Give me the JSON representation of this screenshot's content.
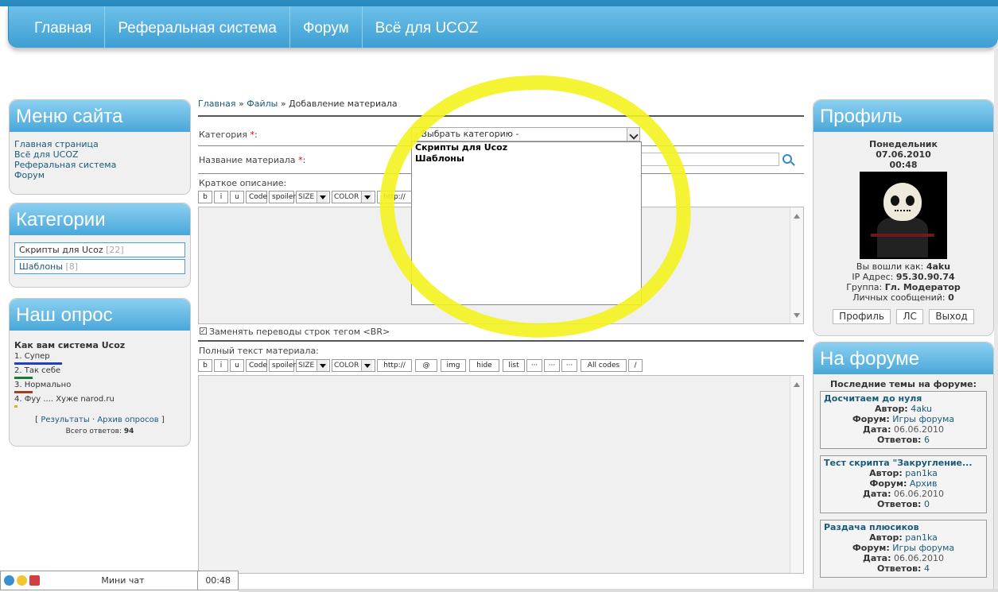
{
  "nav": [
    "Главная",
    "Реферальная система",
    "Форум",
    "Всё для UCOZ"
  ],
  "site_menu": {
    "title": "Меню сайта",
    "links": [
      "Главная страница",
      "Всё для UCOZ",
      "Реферальная система",
      "Форум"
    ]
  },
  "categories": {
    "title": "Категории",
    "items": [
      {
        "label": "Скрипты для Ucoz",
        "count": "[22]"
      },
      {
        "label": "Шаблоны",
        "count": "[8]"
      }
    ]
  },
  "poll": {
    "title": "Наш опрос",
    "question": "Как вам система Ucoz",
    "answers": [
      {
        "label": "1. Супер",
        "share": 0.65,
        "color": "#2040c0"
      },
      {
        "label": "2. Так себе",
        "share": 0.25,
        "color": "#1a7a3a"
      },
      {
        "label": "3. Нормально",
        "share": 0.25,
        "color": "#a04020"
      },
      {
        "label": "4. Фуу .... Хуже narod.ru",
        "share": 0.03,
        "color": "#d8b020"
      }
    ],
    "results_link": "Результаты",
    "archive_link": "Архив опросов",
    "bracket_open": "[",
    "bracket_close": "]",
    "sep": "·",
    "total_label": "Всего ответов:",
    "total": "94"
  },
  "breadcrumb": {
    "home": "Главная",
    "sep": "»",
    "files": "Файлы",
    "current": "Добавление материала"
  },
  "form": {
    "category_label": "Категория",
    "required_mark": "*",
    "label_suffix": ":",
    "category_select": "- Выбрать категорию -",
    "category_options": [
      "Скрипты для Ucoz",
      "Шаблоны"
    ],
    "title_label": "Название материала",
    "short_label": "Краткое описание:",
    "br_label": "Заменять переводы строк тегом <BR>",
    "checkmark": "✓",
    "full_label": "Полный текст материала:"
  },
  "toolbar_short": [
    "b",
    "i",
    "u",
    "Code",
    "spoiler",
    "SIZE",
    "COLOR",
    "http://"
  ],
  "toolbar_full": [
    "b",
    "i",
    "u",
    "Code",
    "spoiler",
    "SIZE",
    "COLOR",
    "http://",
    "@",
    "img",
    "hide",
    "list",
    "···",
    "···",
    "···",
    "All codes",
    "/"
  ],
  "profile": {
    "title": "Профиль",
    "day": "Понедельник",
    "date": "07.06.2010",
    "time": "00:48",
    "logged_label": "Вы вошли как:",
    "user": "4aku",
    "ip_label": "IP Адрес:",
    "ip": "95.30.90.74",
    "group_label": "Группа:",
    "group": "Гл. Модератор",
    "pm_label": "Личных сообщений:",
    "pm": "0",
    "buttons": [
      "Профиль",
      "ЛС",
      "Выход"
    ]
  },
  "forum": {
    "title": "На форуме",
    "subtitle": "Последние темы на форуме:",
    "author_label": "Автор:",
    "forum_label": "Форум:",
    "date_label": "Дата:",
    "replies_label": "Ответов:",
    "topics": [
      {
        "title": "Досчитаем до нуля",
        "author": "4aku",
        "forum": "Игры форума",
        "date": "06.06.2010",
        "replies": "6"
      },
      {
        "title": "Тест скрипта \"Закругление...",
        "author": "pan1ka",
        "forum": "Архив",
        "date": "06.06.2010",
        "replies": "0"
      },
      {
        "title": "Раздача плюсиков",
        "author": "pan1ka",
        "forum": "Игры форума",
        "date": "06.06.2010",
        "replies": "4"
      }
    ]
  },
  "minichat": {
    "title": "Мини чат",
    "time": "00:48"
  },
  "colors": {
    "accent": "#49a7d9",
    "highlight": "#f4f31e"
  }
}
